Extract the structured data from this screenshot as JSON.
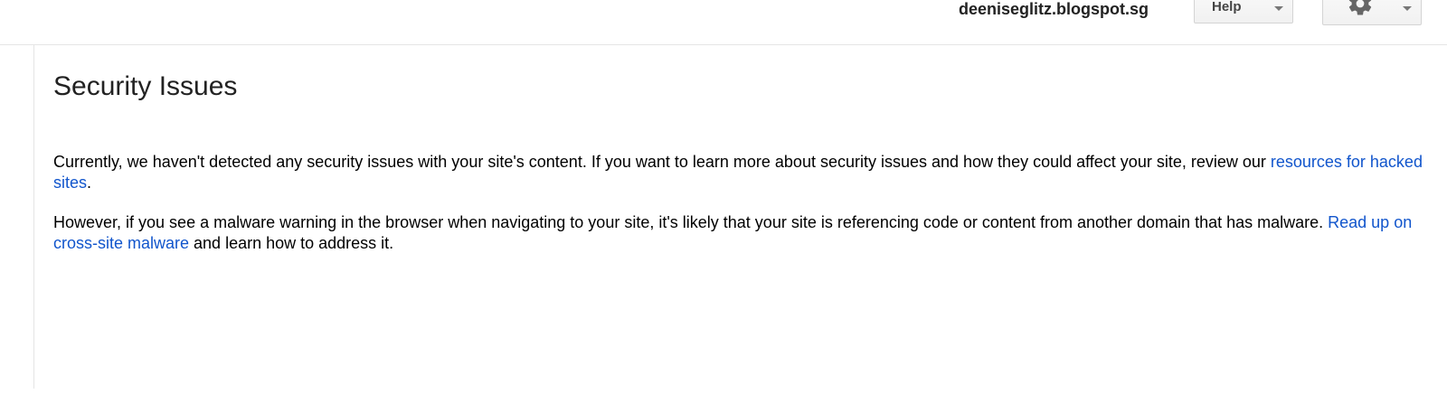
{
  "header": {
    "site_name": "deeniseglitz.blogspot.sg",
    "help_label": "Help"
  },
  "icons": {
    "gear": "gear-icon",
    "help_dropdown": "chevron-down-icon",
    "settings_dropdown": "chevron-down-icon"
  },
  "colors": {
    "link": "#1155cc",
    "text": "#000000",
    "title": "#222222"
  },
  "main": {
    "title": "Security Issues",
    "paragraph1": {
      "text": "Currently, we haven't detected any security issues with your site's content. If you want to learn more about security issues and how they could affect your site, review our ",
      "link": "resources for hacked sites",
      "after": "."
    },
    "paragraph2": {
      "text": "However, if you see a malware warning in the browser when navigating to your site, it's likely that your site is referencing code or content from another domain that has malware. ",
      "link": "Read up on cross-site malware",
      "after": " and learn how to address it."
    }
  }
}
